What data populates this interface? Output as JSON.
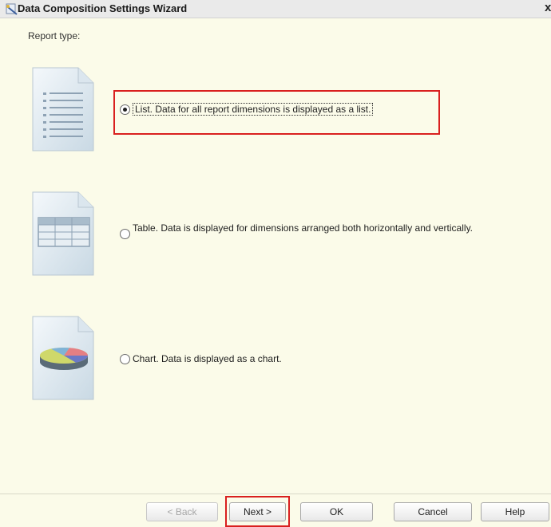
{
  "window": {
    "title": "Data Composition Settings Wizard",
    "close_glyph": "x"
  },
  "report_type": {
    "label": "Report type:",
    "options": [
      {
        "label": "List. Data for all report dimensions is displayed as a list.",
        "selected": true,
        "icon": "list-document-icon"
      },
      {
        "label": "Table. Data is displayed for dimensions arranged both horizontally and vertically.",
        "selected": false,
        "icon": "table-document-icon"
      },
      {
        "label": "Chart. Data is displayed as a chart.",
        "selected": false,
        "icon": "chart-document-icon"
      }
    ]
  },
  "buttons": {
    "back": "< Back",
    "next": "Next >",
    "ok": "OK",
    "cancel": "Cancel",
    "help": "Help"
  },
  "colors": {
    "background": "#fbfbe9",
    "highlight": "#d9201f"
  }
}
